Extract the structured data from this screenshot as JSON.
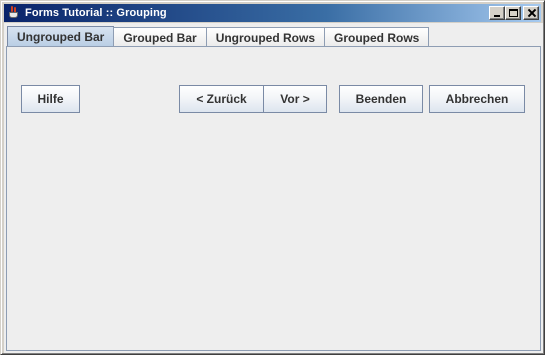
{
  "window": {
    "title": "Forms Tutorial :: Grouping",
    "icon": "java-cup-icon",
    "controls": [
      "minimize",
      "maximize",
      "close"
    ]
  },
  "tabs": [
    {
      "label": "Ungrouped Bar",
      "selected": true
    },
    {
      "label": "Grouped Bar",
      "selected": false
    },
    {
      "label": "Ungrouped Rows",
      "selected": false
    },
    {
      "label": "Grouped Rows",
      "selected": false
    }
  ],
  "buttons": {
    "help": "Hilfe",
    "back": "< Zurück",
    "next": "Vor >",
    "finish": "Beenden",
    "cancel": "Abbrechen"
  }
}
